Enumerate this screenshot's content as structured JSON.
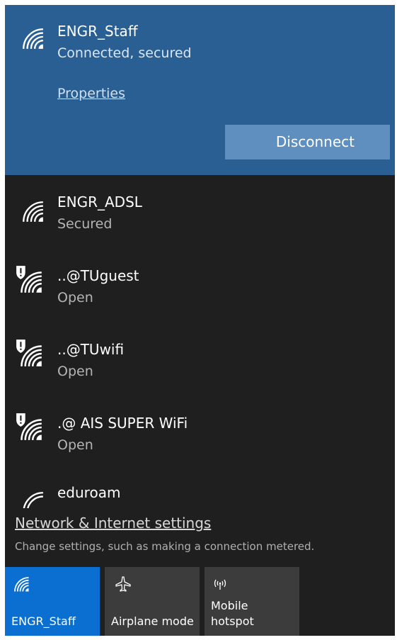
{
  "connected_network": {
    "name": "ENGR_Staff",
    "status": "Connected, secured",
    "properties_label": "Properties",
    "disconnect_label": "Disconnect"
  },
  "networks": [
    {
      "name": "ENGR_ADSL",
      "status": "Secured",
      "icon": "wifi-icon"
    },
    {
      "name": "..@TUguest",
      "status": "Open",
      "icon": "wifi-shield-icon"
    },
    {
      "name": "..@TUwifi",
      "status": "Open",
      "icon": "wifi-shield-icon"
    },
    {
      "name": ".@ AIS SUPER WiFi",
      "status": "Open",
      "icon": "wifi-shield-icon"
    },
    {
      "name": "eduroam",
      "status": "",
      "icon": "wifi-weak-icon"
    }
  ],
  "footer": {
    "settings_link": "Network & Internet settings",
    "settings_description": "Change settings, such as making a connection metered."
  },
  "quick_actions": [
    {
      "label": "ENGR_Staff",
      "icon": "wifi-icon",
      "active": true
    },
    {
      "label": "Airplane mode",
      "icon": "airplane-icon",
      "active": false
    },
    {
      "label_line1": "Mobile",
      "label_line2": "hotspot",
      "icon": "hotspot-icon",
      "active": false
    }
  ],
  "colors": {
    "panel_background": "#1f1f1f",
    "connected_background": "#2a5f94",
    "disconnect_button": "#5f8fbf",
    "active_tile": "#0a6fd1",
    "tile": "#3c3c3c"
  }
}
